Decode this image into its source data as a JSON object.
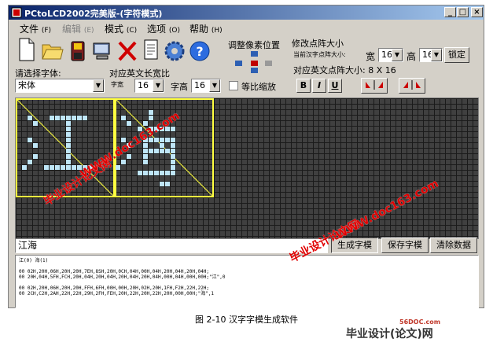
{
  "window": {
    "title": "PCtoLCD2002完美版-(字符模式)"
  },
  "title_buttons": {
    "minimize": "_",
    "maximize": "□",
    "close": "×"
  },
  "menus": [
    {
      "label": "文件",
      "hotkey": "(F)",
      "enabled": true
    },
    {
      "label": "编辑",
      "hotkey": "(E)",
      "enabled": false
    },
    {
      "label": "模式",
      "hotkey": "(C)",
      "enabled": true
    },
    {
      "label": "选项",
      "hotkey": "(O)",
      "enabled": true
    },
    {
      "label": "帮助",
      "hotkey": "(H)",
      "enabled": true
    }
  ],
  "toolbar_icons": [
    "new-file-icon",
    "open-folder-icon",
    "save-disk-icon",
    "computer-icon",
    "delete-x-icon",
    "document-icon",
    "settings-gear-icon",
    "help-icon"
  ],
  "pixel_adjust": {
    "label": "调整像素位置"
  },
  "dot_matrix": {
    "label": "修改点阵大小",
    "current_label": "当前汉字点阵大小:",
    "width_label": "宽",
    "width_value": "16",
    "height_label": "高",
    "height_value": "16",
    "lock_button": "锁定",
    "english_label": "对应英文点阵大小: 8 X 16"
  },
  "font": {
    "label": "请选择字体:",
    "value": "宋体"
  },
  "ratio": {
    "label": "对应英文长宽比",
    "width_label": "字宽",
    "width_value": "16",
    "height_label": "字高",
    "height_value": "16",
    "proportional_label": "等比缩放",
    "proportional_checked": false
  },
  "style_buttons": {
    "bold": "B",
    "italic": "I",
    "underline": "U"
  },
  "input": {
    "text": "江海"
  },
  "actions": {
    "generate": "生成字模",
    "save": "保存字模",
    "clear": "清除数据"
  },
  "output": {
    "lines": [
      "江(0) 海(1)",
      "",
      "00 02H,20H,06H,20H,20H,7EH,8SH,20H,0CH,04H,00H,04H,20H,04H,20H,04H;",
      "00 20H,04H,5FH,FCH,20H,04H,20H,04H,20H,04H,20H,04H,00H,04H,00H,00H;\"江\",0",
      "",
      "00 02H,20H,06H,20H,20H,FFH,6FH,00H,00H,20H,02H,20H,1FH,F2H,22H,22H;",
      "00 2CH,C2H,2AH,22H,22H,29H,2FH,FEH,20H,22H,20H,22H,20H,00H,00H;\"海\",1"
    ]
  },
  "watermarks": [
    "毕业设计论文网",
    "WWW.doc163.com"
  ],
  "caption": "图 2-10 汉字字模生成软件",
  "footer": {
    "site": "56DOC.com",
    "logo": "毕业设计(论文)网"
  },
  "colors": {
    "grid_bg": "#404040",
    "pixel_on": "#bfe6f7",
    "selection": "#ffff40",
    "watermark": "#e00000",
    "titlebar": "#0a246a"
  }
}
